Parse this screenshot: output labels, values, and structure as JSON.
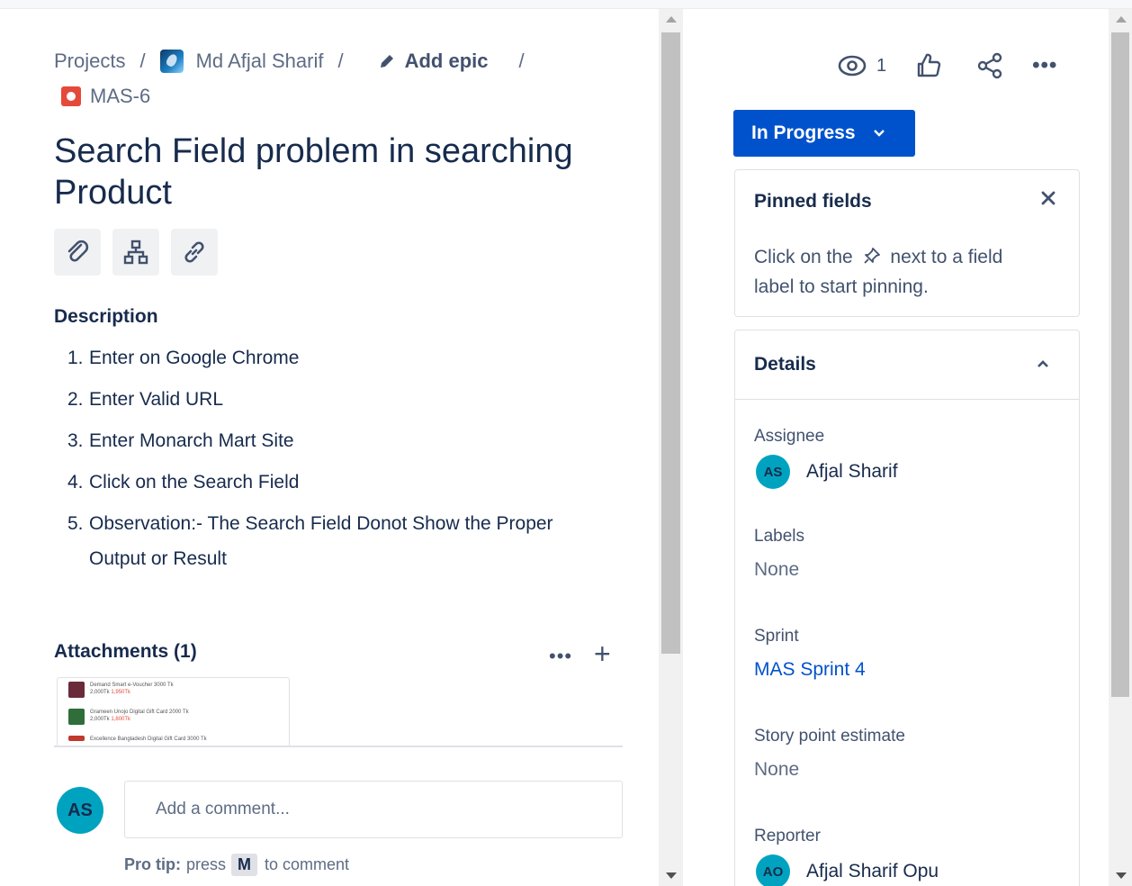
{
  "breadcrumb": {
    "projects": "Projects",
    "separator": "/",
    "project_name": "Md Afjal Sharif",
    "add_epic": "Add epic",
    "issue_key": "MAS-6"
  },
  "issue": {
    "title": "Search Field problem in searching Product"
  },
  "description": {
    "label": "Description",
    "steps": [
      {
        "num": "1.",
        "text": "Enter on Google Chrome"
      },
      {
        "num": "2.",
        "text": "Enter Valid URL"
      },
      {
        "num": "3.",
        "text": "Enter Monarch Mart Site"
      },
      {
        "num": "4.",
        "text": "Click on the Search Field"
      },
      {
        "num": "5.",
        "text": "Observation:- The Search Field Donot Show the Proper Output or Result"
      }
    ]
  },
  "attachments": {
    "label": "Attachments (1)",
    "more_label": "•••",
    "add_label": "+",
    "thumbnail_rows": [
      {
        "title": "Demand Smart e-Voucher 3000 Tk",
        "price_old": "2,000Tk",
        "price_new": "1,950Tk"
      },
      {
        "title": "Grameen Unojo Digital Gift Card 2000 Tk",
        "price_old": "2,000Tk",
        "price_new": "1,800Tk"
      },
      {
        "title": "Excellence Bangladesh Digital Gift Card 3000 Tk",
        "price_old": "",
        "price_new": ""
      }
    ]
  },
  "comment": {
    "avatar_initials": "AS",
    "placeholder": "Add a comment...",
    "tip_prefix": "Pro tip:",
    "tip_press": "press",
    "tip_key": "M",
    "tip_suffix": "to comment"
  },
  "actions": {
    "watch_count": "1",
    "more_label": "•••"
  },
  "status": {
    "label": "In Progress"
  },
  "pinned": {
    "title": "Pinned fields",
    "text_before": "Click on the",
    "text_after": "next to a field label to start pinning."
  },
  "details": {
    "title": "Details",
    "assignee_label": "Assignee",
    "assignee_initials": "AS",
    "assignee_name": "Afjal Sharif",
    "labels_label": "Labels",
    "labels_value": "None",
    "sprint_label": "Sprint",
    "sprint_value": "MAS Sprint 4",
    "story_points_label": "Story point estimate",
    "story_points_value": "None",
    "reporter_label": "Reporter",
    "reporter_initials": "AO",
    "reporter_name": "Afjal Sharif Opu"
  },
  "colors": {
    "primary": "#0052cc",
    "avatar": "#00a3bf",
    "bug": "#e5493a",
    "text": "#172b4d",
    "subtle": "#5e6c84"
  }
}
